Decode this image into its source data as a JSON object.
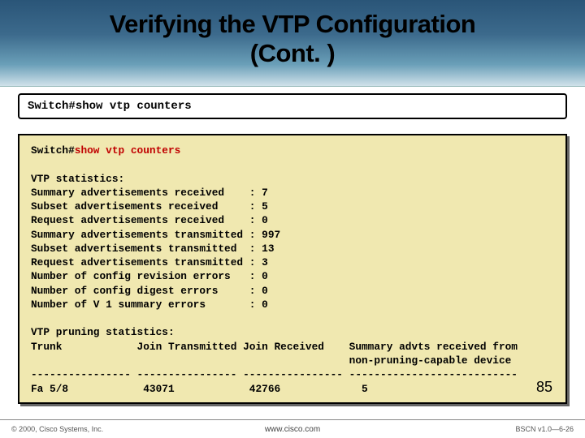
{
  "slide": {
    "title_line1": "Verifying the VTP Configuration",
    "title_line2": "(Cont. )",
    "page_number": "85"
  },
  "command_box": {
    "prompt": "Switch#",
    "command": "show vtp counters"
  },
  "terminal": {
    "prompt": "Switch#",
    "command": "show vtp counters",
    "stats_header": "VTP statistics:",
    "rows": [
      {
        "label": "Summary advertisements received   ",
        "value": "7"
      },
      {
        "label": "Subset advertisements received    ",
        "value": "5"
      },
      {
        "label": "Request advertisements received   ",
        "value": "0"
      },
      {
        "label": "Summary advertisements transmitted",
        "value": "997"
      },
      {
        "label": "Subset advertisements transmitted ",
        "value": "13"
      },
      {
        "label": "Request advertisements transmitted",
        "value": "3"
      },
      {
        "label": "Number of config revision errors  ",
        "value": "0"
      },
      {
        "label": "Number of config digest errors    ",
        "value": "0"
      },
      {
        "label": "Number of V 1 summary errors      ",
        "value": "0"
      }
    ],
    "pruning_header": "VTP pruning statistics:",
    "table_header": "Trunk            Join Transmitted Join Received    Summary advts received from\n                                                   non-pruning-capable device",
    "table_divider": "---------------- ---------------- ---------------- ---------------------------",
    "table_row": "Fa 5/8            43071            42766             5"
  },
  "footer": {
    "left": "© 2000, Cisco Systems, Inc.",
    "center": "www.cisco.com",
    "right": "BSCN v1.0—6-26"
  }
}
